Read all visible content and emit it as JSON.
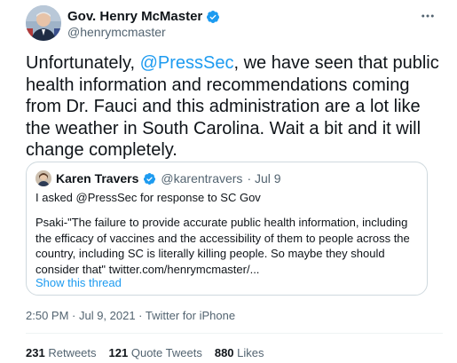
{
  "author": {
    "name": "Gov. Henry McMaster",
    "handle": "@henrymcmaster",
    "verified": true,
    "avatar_icon": "profile-photo"
  },
  "more_icon": "more-options-icon",
  "tweet": {
    "text_before": "Unfortunately, ",
    "mention": "@PressSec",
    "text_after": ", we have seen that public health information and recommendations coming from Dr. Fauci and this administration are a lot like the weather in South Carolina.  Wait a bit and it will change completely."
  },
  "quoted": {
    "name": "Karen Travers",
    "handle": "@karentravers",
    "date": "· Jul 9",
    "line1": "I asked @PressSec for response to SC Gov",
    "body": "Psaki-\"The failure to provide accurate public health information, including the efficacy of vaccines and the accessibility of them to people across the country, including SC is literally killing people. So maybe they should consider that\" twitter.com/henrymcmaster/...",
    "show_thread": "Show this thread"
  },
  "meta": {
    "time": "2:50 PM · Jul 9, 2021 · ",
    "source": "Twitter for iPhone"
  },
  "stats": {
    "retweets_count": "231",
    "retweets_label": "Retweets",
    "quotes_count": "121",
    "quotes_label": "Quote Tweets",
    "likes_count": "880",
    "likes_label": "Likes"
  },
  "colors": {
    "accent": "#1d9bf0",
    "secondary_text": "#536471",
    "border": "#cfd9de"
  }
}
